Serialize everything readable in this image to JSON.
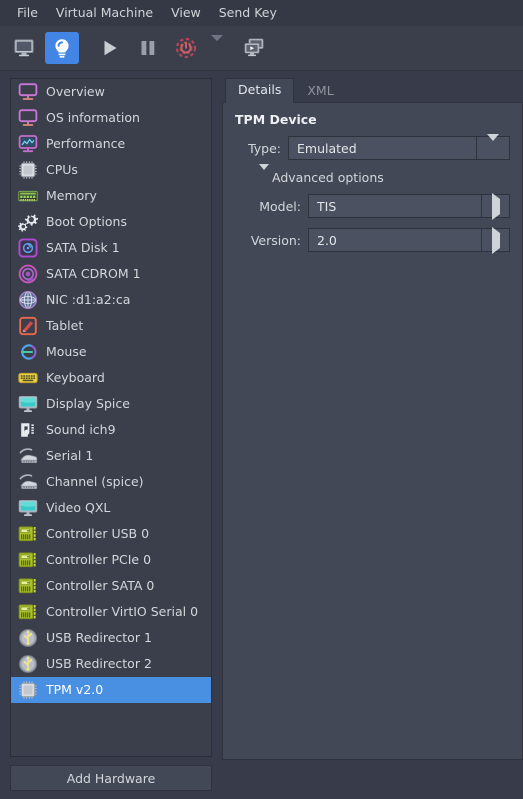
{
  "menubar": {
    "items": [
      {
        "label": "File",
        "name": "menu-file"
      },
      {
        "label": "Virtual Machine",
        "name": "menu-virtual-machine"
      },
      {
        "label": "View",
        "name": "menu-view"
      },
      {
        "label": "Send Key",
        "name": "menu-send-key"
      }
    ]
  },
  "toolbar": {
    "buttons": [
      {
        "icon": "monitor-console-icon",
        "name": "show-graphical-console-button",
        "active": false
      },
      {
        "icon": "lightbulb-details-icon",
        "name": "show-virtual-hardware-details-button",
        "active": true
      },
      {
        "icon": "play-icon",
        "name": "run-button",
        "active": false
      },
      {
        "icon": "pause-icon",
        "name": "pause-button",
        "active": false
      },
      {
        "icon": "power-shutdown-icon",
        "name": "shutdown-button",
        "active": false
      },
      {
        "icon": "chevron-down-icon",
        "name": "shutdown-menu-dropdown",
        "active": false
      },
      {
        "icon": "dual-monitor-snapshot-icon",
        "name": "manage-snapshots-button",
        "active": false
      }
    ]
  },
  "sidebar": {
    "add_hardware_label": "Add Hardware",
    "items": [
      {
        "label": "Overview",
        "icon": "monitor-pink-icon",
        "selected": false
      },
      {
        "label": "OS information",
        "icon": "monitor-pink-icon",
        "selected": false
      },
      {
        "label": "Performance",
        "icon": "performance-graph-icon",
        "selected": false
      },
      {
        "label": "CPUs",
        "icon": "cpu-chip-icon",
        "selected": false
      },
      {
        "label": "Memory",
        "icon": "memory-stick-icon",
        "selected": false
      },
      {
        "label": "Boot Options",
        "icon": "gears-icon",
        "selected": false
      },
      {
        "label": "SATA Disk 1",
        "icon": "hard-disk-icon",
        "selected": false
      },
      {
        "label": "SATA CDROM 1",
        "icon": "optical-disc-icon",
        "selected": false
      },
      {
        "label": "NIC :d1:a2:ca",
        "icon": "network-globe-icon",
        "selected": false
      },
      {
        "label": "Tablet",
        "icon": "tablet-pen-icon",
        "selected": false
      },
      {
        "label": "Mouse",
        "icon": "mouse-icon",
        "selected": false
      },
      {
        "label": "Keyboard",
        "icon": "keyboard-icon",
        "selected": false
      },
      {
        "label": "Display Spice",
        "icon": "display-monitor-icon",
        "selected": false
      },
      {
        "label": "Sound ich9",
        "icon": "sound-note-icon",
        "selected": false
      },
      {
        "label": "Serial 1",
        "icon": "serial-cable-icon",
        "selected": false
      },
      {
        "label": "Channel (spice)",
        "icon": "serial-cable-icon",
        "selected": false
      },
      {
        "label": "Video QXL",
        "icon": "display-monitor-icon",
        "selected": false
      },
      {
        "label": "Controller USB 0",
        "icon": "controller-card-icon",
        "selected": false
      },
      {
        "label": "Controller PCIe 0",
        "icon": "controller-card-icon",
        "selected": false
      },
      {
        "label": "Controller SATA 0",
        "icon": "controller-card-icon",
        "selected": false
      },
      {
        "label": "Controller VirtIO Serial 0",
        "icon": "controller-card-icon",
        "selected": false
      },
      {
        "label": "USB Redirector 1",
        "icon": "usb-icon",
        "selected": false
      },
      {
        "label": "USB Redirector 2",
        "icon": "usb-icon",
        "selected": false
      },
      {
        "label": "TPM v2.0",
        "icon": "cpu-chip-icon",
        "selected": true
      }
    ]
  },
  "details": {
    "tabs": [
      {
        "label": "Details",
        "active": true
      },
      {
        "label": "XML",
        "active": false
      }
    ],
    "section_title": "TPM Device",
    "type_label": "Type:",
    "type_value": "Emulated",
    "advanced_label": "Advanced options",
    "model_label": "Model:",
    "model_value": "TIS",
    "version_label": "Version:",
    "version_value": "2.0"
  },
  "colors": {
    "window_bg": "#383c4a",
    "panel_bg": "#434857",
    "list_bg": "#3b3f4c",
    "selection": "#4a90e2",
    "accent_active": "#4285e4",
    "text": "#d3d7da",
    "text_muted": "#8e939c",
    "border": "#2f323c"
  }
}
